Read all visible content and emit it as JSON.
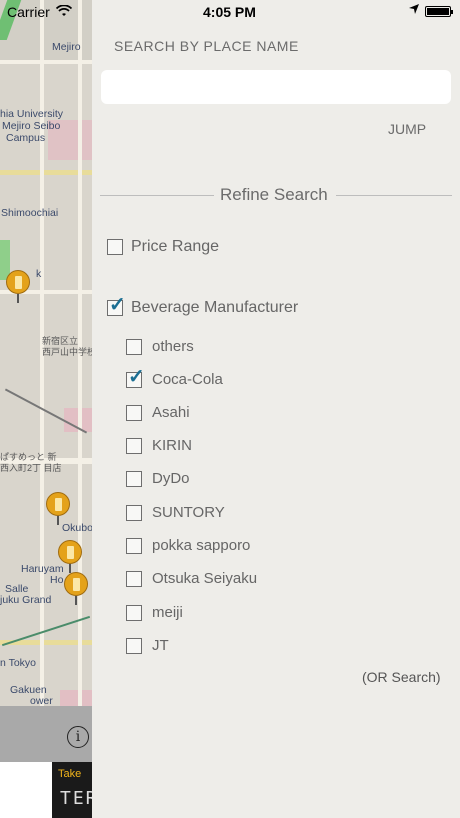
{
  "status_bar": {
    "carrier": "Carrier",
    "wifi_icon": "wifi-icon",
    "time": "4:05 PM",
    "location_icon": "location-arrow-icon",
    "battery_icon": "battery-icon"
  },
  "map": {
    "labels": {
      "mejiro": "Mejiro",
      "univ1": "hia University",
      "univ2": "Mejiro Seibo",
      "univ3": "Campus",
      "shimoochiai": "Shimoochiai",
      "k": "k",
      "jp1": "新宿区立",
      "jp2": "西戸山中学校",
      "jp3": "ぱすめっと 新",
      "jp4": "西入町2丁 目店",
      "okubo": "Okubo",
      "haruyama": "Haruyam",
      "ho": "Ho",
      "salle": "Salle",
      "juku": "juku Grand",
      "tokyo": "n Tokyo",
      "gakuen": "Gakuen",
      "wer": "ower"
    },
    "info_icon": "info-icon",
    "ad": {
      "line1": "Take",
      "line2": "TER"
    }
  },
  "panel": {
    "search_label": "SEARCH BY PLACE NAME",
    "search_value": "",
    "search_placeholder": "",
    "jump_label": "JUMP",
    "refine_title": "Refine Search",
    "price_range": {
      "label": "Price Range",
      "checked": false
    },
    "beverage_manufacturer": {
      "label": "Beverage Manufacturer",
      "checked": true
    },
    "manufacturers": [
      {
        "label": "others",
        "checked": false
      },
      {
        "label": "Coca-Cola",
        "checked": true
      },
      {
        "label": "Asahi",
        "checked": false
      },
      {
        "label": "KIRIN",
        "checked": false
      },
      {
        "label": "DyDo",
        "checked": false
      },
      {
        "label": "SUNTORY",
        "checked": false
      },
      {
        "label": "pokka sapporo",
        "checked": false
      },
      {
        "label": "Otsuka Seiyaku",
        "checked": false
      },
      {
        "label": "meiji",
        "checked": false
      },
      {
        "label": "JT",
        "checked": false
      }
    ],
    "or_search": "(OR Search)",
    "accent_color": "#1c6f93"
  }
}
